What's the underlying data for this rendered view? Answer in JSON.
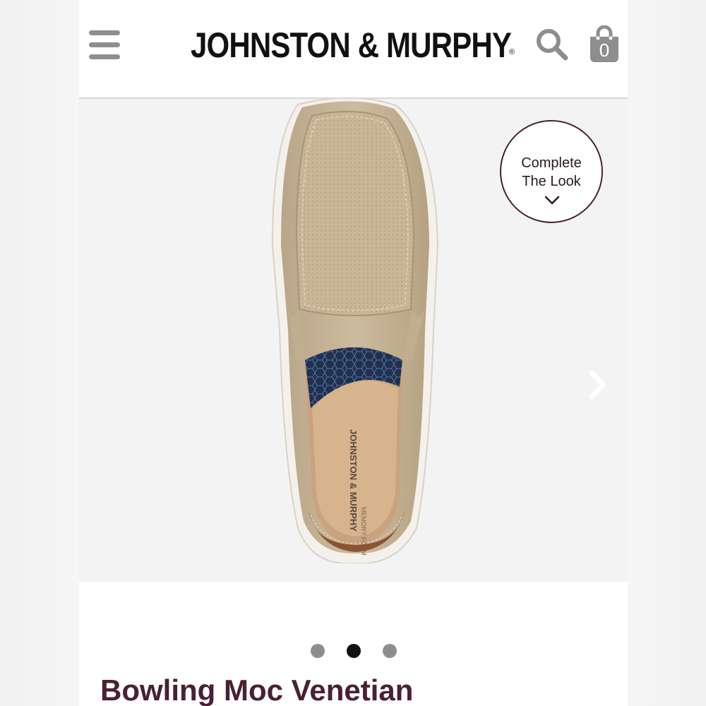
{
  "header": {
    "logo_text": "JOHNSTON & MURPHY",
    "logo_registered": "®",
    "menu_icon": "hamburger-menu-icon",
    "search_icon": "search-icon",
    "cart_icon": "shopping-bag-icon",
    "cart_count": "0"
  },
  "gallery": {
    "image_subject": "tan slip-on shoe, top view",
    "insole_brand_text": "JOHNSTON & MURPHY",
    "insole_sub_text": "MEMORY FOAM",
    "complete_look": {
      "line1": "Complete",
      "line2": "The Look",
      "icon": "chevron-down-icon"
    },
    "next_icon": "chevron-right-icon",
    "pagination": {
      "total": 3,
      "active_index": 1
    }
  },
  "product": {
    "title": "Bowling Moc Venetian"
  },
  "colors": {
    "brand_plum": "#4a2035",
    "icon_gray": "#8e8e8e",
    "shoe_tan": "#c9b79a",
    "heel_brown": "#8a5334",
    "lining_navy": "#1f3152"
  }
}
